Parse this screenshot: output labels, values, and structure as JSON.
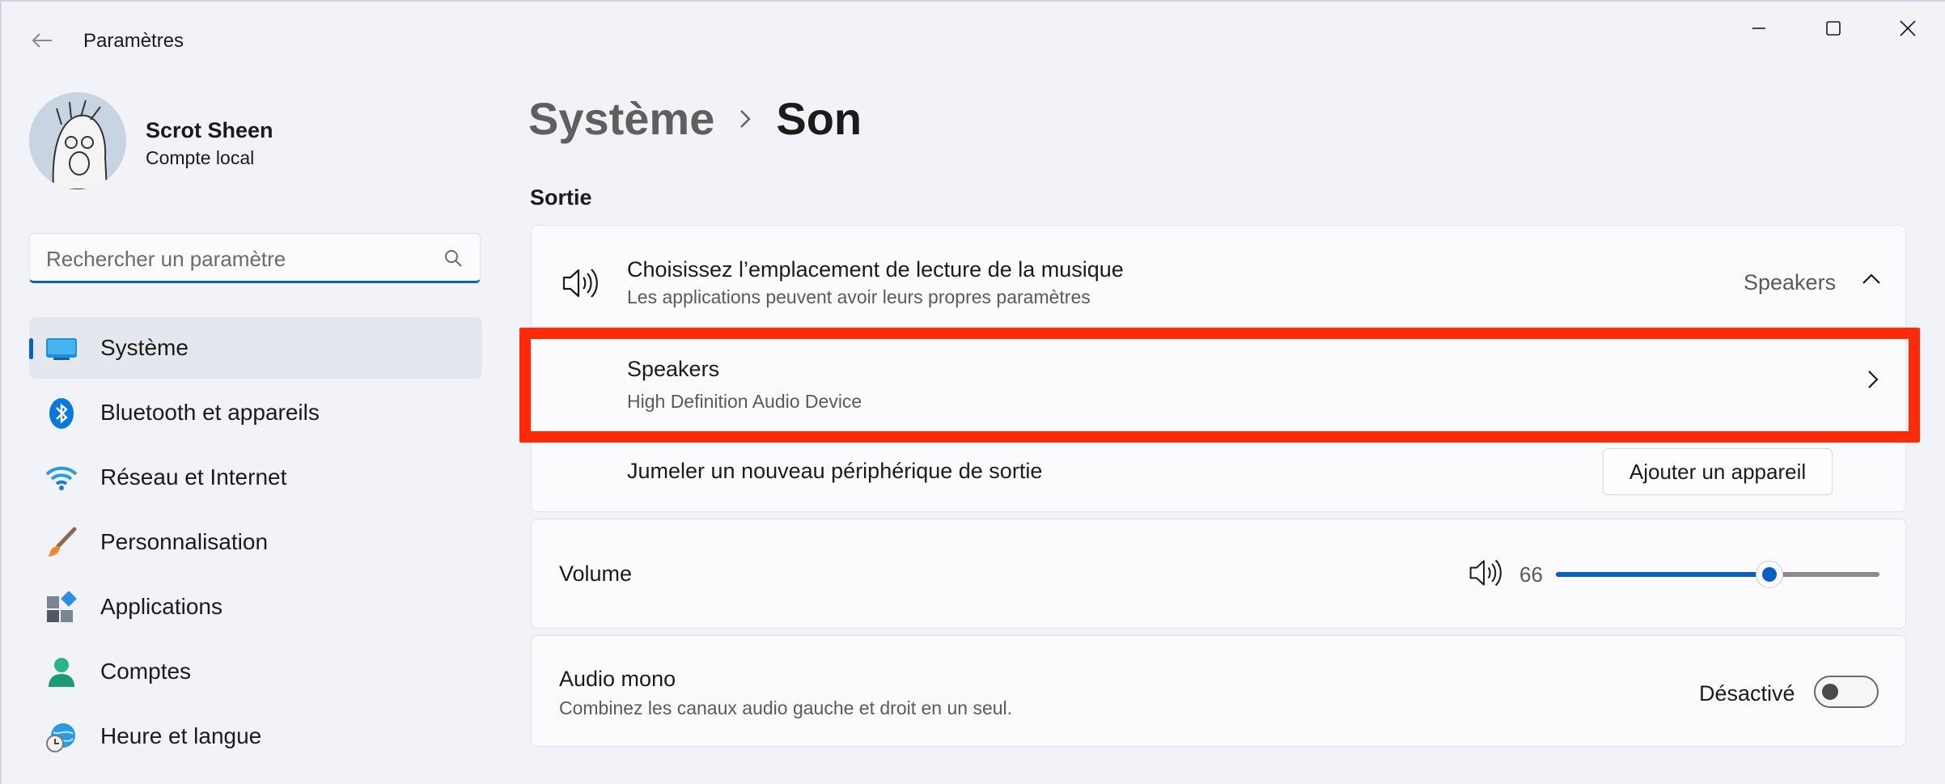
{
  "window": {
    "app_title": "Paramètres"
  },
  "profile": {
    "name": "Scrot Sheen",
    "account_type": "Compte local"
  },
  "search": {
    "placeholder": "Rechercher un paramètre"
  },
  "sidebar": {
    "items": [
      {
        "label": "Système",
        "icon": "system-icon",
        "active": true
      },
      {
        "label": "Bluetooth et appareils",
        "icon": "bluetooth-icon",
        "active": false
      },
      {
        "label": "Réseau et Internet",
        "icon": "wifi-icon",
        "active": false
      },
      {
        "label": "Personnalisation",
        "icon": "brush-icon",
        "active": false
      },
      {
        "label": "Applications",
        "icon": "apps-icon",
        "active": false
      },
      {
        "label": "Comptes",
        "icon": "person-icon",
        "active": false
      },
      {
        "label": "Heure et langue",
        "icon": "clock-globe-icon",
        "active": false
      }
    ]
  },
  "breadcrumb": {
    "parent": "Système",
    "current": "Son"
  },
  "output": {
    "section_title": "Sortie",
    "choose": {
      "title": "Choisissez l’emplacement de lecture de la musique",
      "subtitle": "Les applications peuvent avoir leurs propres paramètres",
      "value": "Speakers"
    },
    "device": {
      "name": "Speakers",
      "description": "High Definition Audio Device"
    },
    "pair": {
      "label": "Jumeler un nouveau périphérique de sortie",
      "button": "Ajouter un appareil"
    }
  },
  "volume": {
    "label": "Volume",
    "value": "66",
    "level": 0.66
  },
  "mono": {
    "title": "Audio mono",
    "subtitle": "Combinez les canaux audio gauche et droit en un seul.",
    "state": "Désactivé"
  },
  "colors": {
    "accent": "#0a5fbf",
    "highlight": "#ff2a0a"
  }
}
